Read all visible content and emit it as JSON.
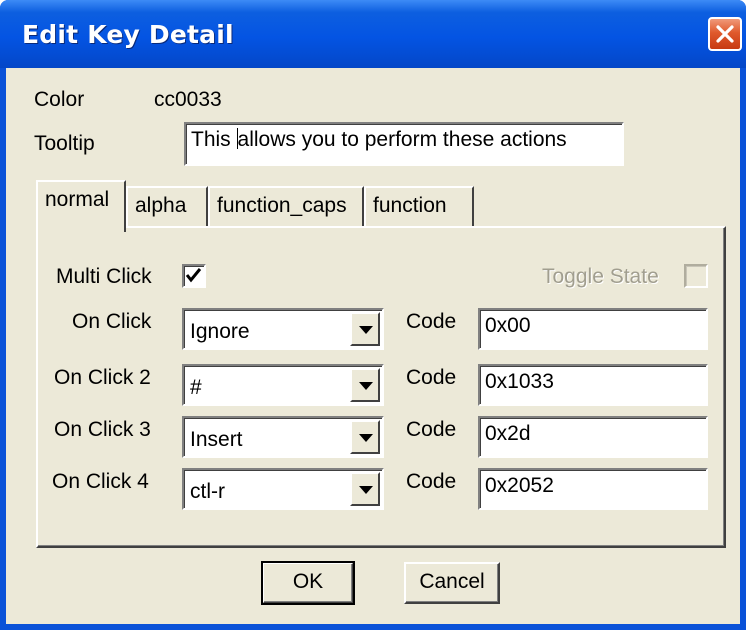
{
  "window": {
    "title": "Edit Key Detail"
  },
  "form": {
    "color_label": "Color",
    "color_value": "cc0033",
    "tooltip_label": "Tooltip",
    "tooltip_before_caret": "This ",
    "tooltip_after_caret": "allows you to perform these actions"
  },
  "tabs": [
    {
      "label": "normal",
      "active": true
    },
    {
      "label": "alpha",
      "active": false
    },
    {
      "label": "function_caps",
      "active": false
    },
    {
      "label": "function",
      "active": false
    }
  ],
  "panel": {
    "multi_click_label": "Multi Click",
    "multi_click_checked": true,
    "toggle_state_label": "Toggle State",
    "toggle_state_enabled": false,
    "rows": [
      {
        "label": "On Click",
        "action": "Ignore",
        "code_label": "Code",
        "code": "0x00"
      },
      {
        "label": "On Click 2",
        "action": "#",
        "code_label": "Code",
        "code": "0x1033"
      },
      {
        "label": "On Click 3",
        "action": "Insert",
        "code_label": "Code",
        "code": "0x2d"
      },
      {
        "label": "On Click 4",
        "action": "ctl-r",
        "code_label": "Code",
        "code": "0x2052"
      }
    ]
  },
  "buttons": {
    "ok": "OK",
    "cancel": "Cancel"
  },
  "icons": {
    "close": "close-icon",
    "checkmark": "checkmark-icon",
    "dropdown": "chevron-down-icon"
  },
  "colors": {
    "titlebar": "#0454e3",
    "close_button": "#e05a2c",
    "dialog_face": "#ece9d8"
  }
}
